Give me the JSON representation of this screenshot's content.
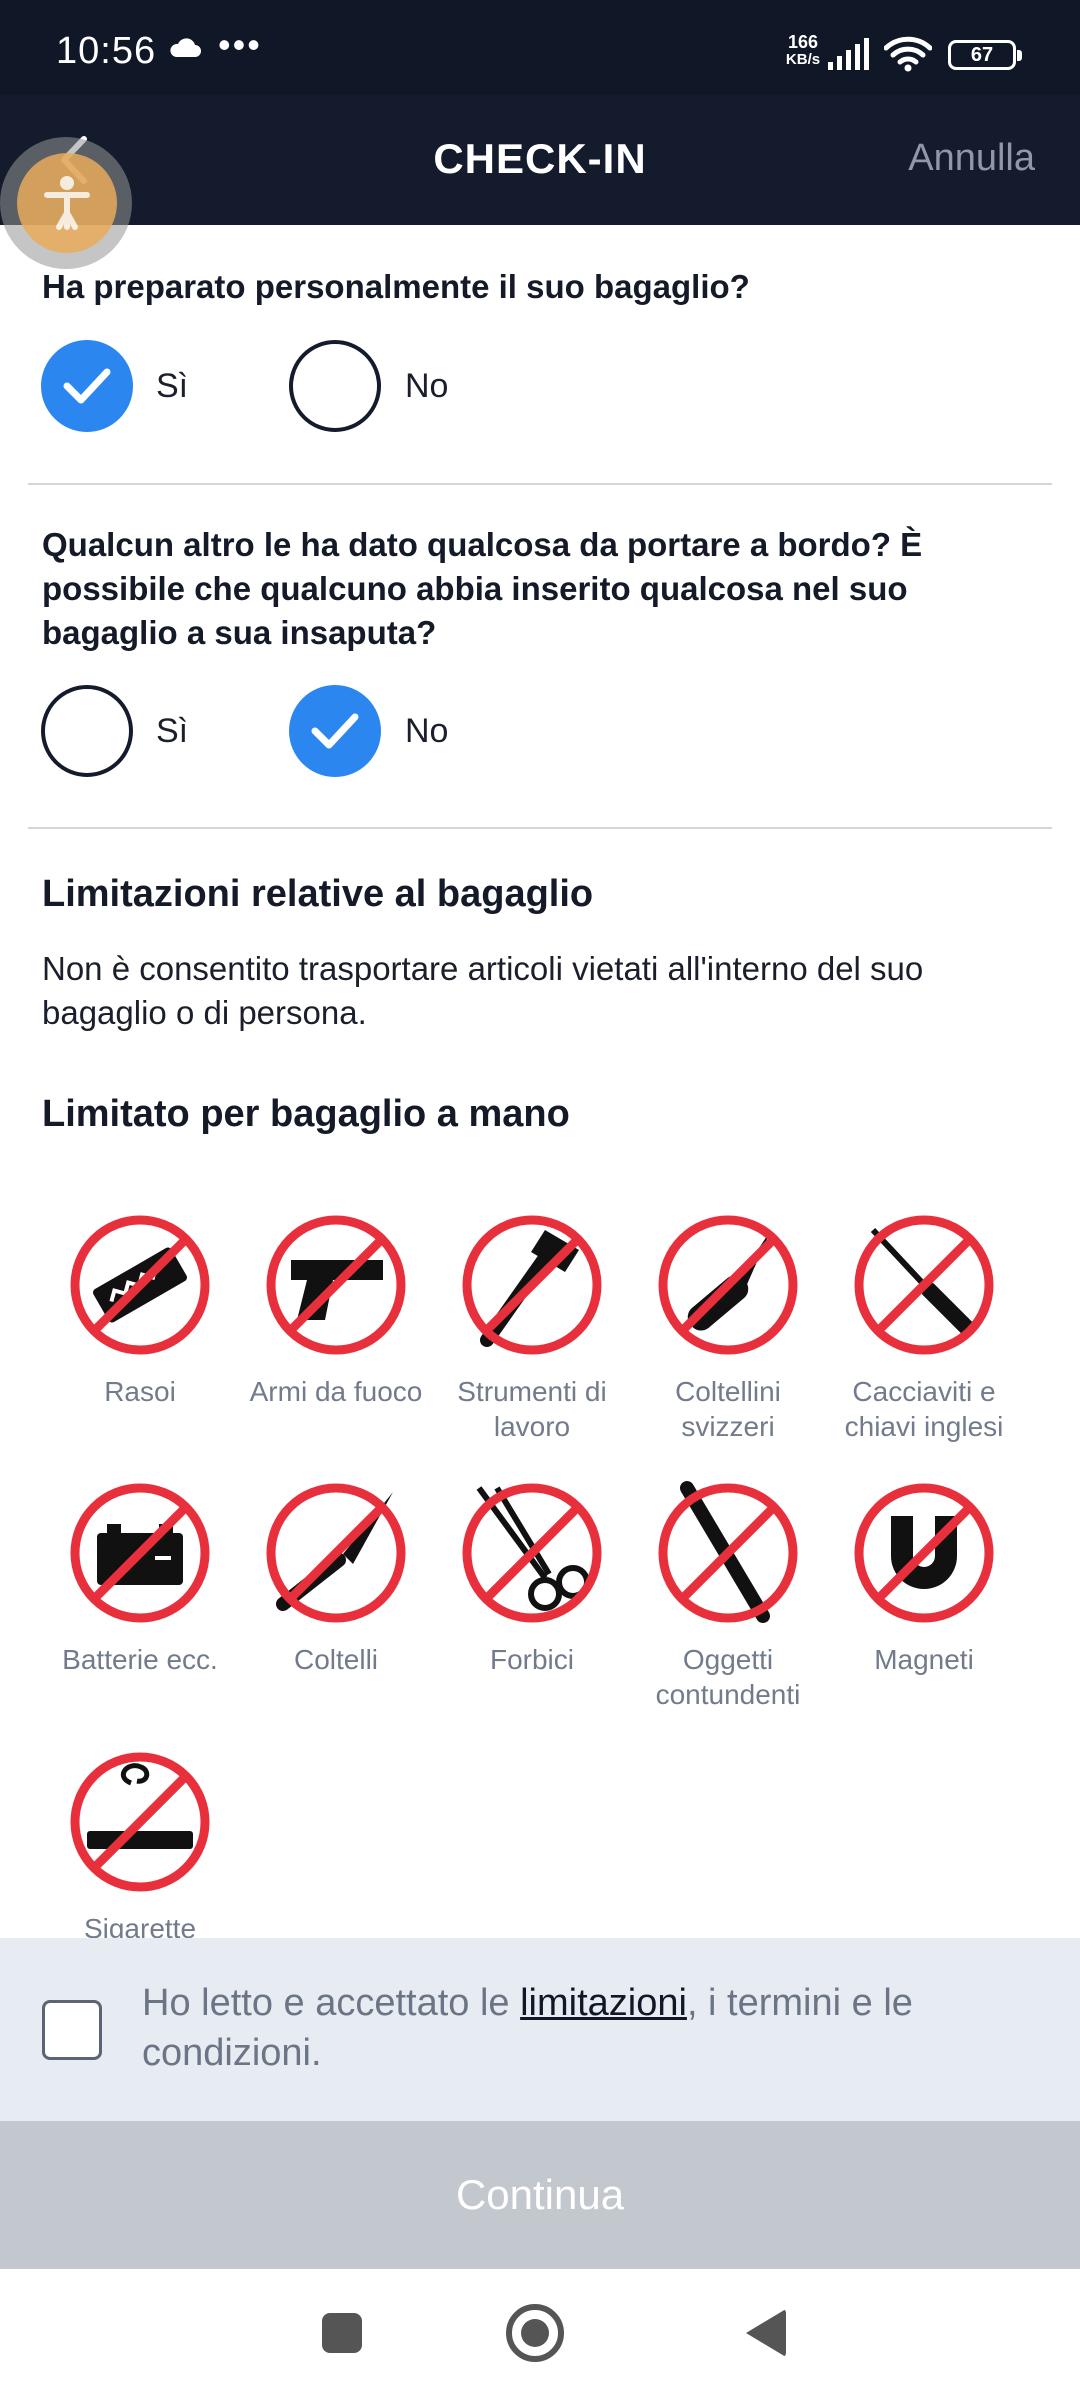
{
  "status_bar": {
    "time": "10:56",
    "dots": "•••",
    "speed_value": "166",
    "speed_unit": "KB/s",
    "battery": "67"
  },
  "app_bar": {
    "title": "CHECK-IN",
    "cancel_label": "Annulla"
  },
  "questions": [
    {
      "text": "Ha preparato personalmente il suo bagaglio?",
      "yes_label": "Sì",
      "no_label": "No",
      "selected": "yes"
    },
    {
      "text": "Qualcun altro le ha dato qualcosa da portare a bordo? È possibile che qualcuno abbia inserito qualcosa nel suo bagaglio a sua insaputa?",
      "yes_label": "Sì",
      "no_label": "No",
      "selected": "no"
    }
  ],
  "restrictions": {
    "title": "Limitazioni relative al bagaglio",
    "description": "Non è consentito trasportare articoli vietati all'interno del suo bagaglio o di persona.",
    "hand_luggage_title": "Limitato per bagaglio a mano",
    "items": [
      {
        "label": "Rasoi",
        "icon": "razor-blade-icon"
      },
      {
        "label": "Armi da fuoco",
        "icon": "gun-icon"
      },
      {
        "label": "Strumenti di lavoro",
        "icon": "tools-icon"
      },
      {
        "label": "Coltellini svizzeri",
        "icon": "swiss-knife-icon"
      },
      {
        "label": "Cacciaviti e chiavi inglesi",
        "icon": "screwdriver-icon"
      },
      {
        "label": "Batterie ecc.",
        "icon": "battery-icon"
      },
      {
        "label": "Coltelli",
        "icon": "knife-icon"
      },
      {
        "label": "Forbici",
        "icon": "scissors-icon"
      },
      {
        "label": "Oggetti contundenti",
        "icon": "bat-icon"
      },
      {
        "label": "Magneti",
        "icon": "magnet-icon"
      },
      {
        "label": "Sigarette",
        "icon": "cigarette-icon"
      }
    ]
  },
  "accept": {
    "text_before": "Ho letto e accettato le ",
    "link_text": "limitazioni",
    "text_after": ", i termini e le condizioni.",
    "checked": false
  },
  "continue_label": "Continua",
  "colors": {
    "header": "#131b2c",
    "accent": "#2b86ef",
    "prohibited": "#e8303d",
    "button_disabled": "#c3c7ce"
  }
}
